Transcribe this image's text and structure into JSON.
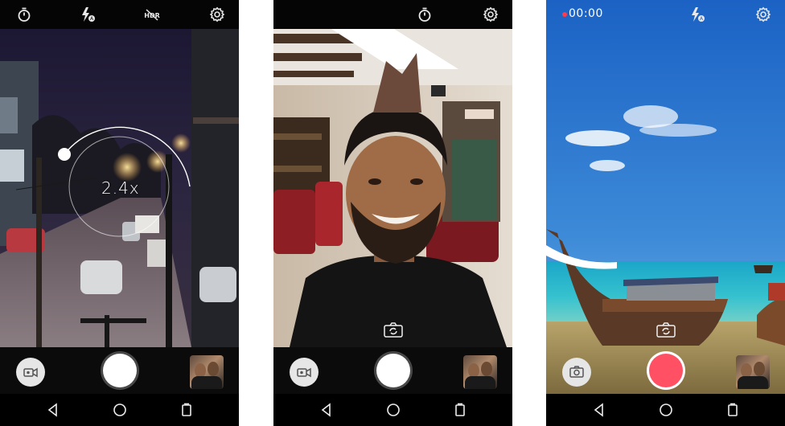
{
  "screens": [
    {
      "id": "photo-night-zoom",
      "zoom_label": "2.4x",
      "top_icons": [
        "timer-icon",
        "flash-auto-icon",
        "hdr-off-icon",
        "settings-icon"
      ],
      "mode_button": "video-icon",
      "shutter": "photo"
    },
    {
      "id": "photo-selfie",
      "top_icons": [
        "timer-icon",
        "settings-icon"
      ],
      "mode_button": "video-icon",
      "shutter": "photo"
    },
    {
      "id": "video-recording",
      "record_time": "00:00",
      "top_icons": [
        "flash-auto-icon",
        "settings-icon"
      ],
      "mode_button": "camera-icon",
      "shutter": "record"
    }
  ],
  "colors": {
    "record": "#ff5064",
    "recording_dot": "#ff3b4d",
    "bar": "#0b0b0b"
  }
}
